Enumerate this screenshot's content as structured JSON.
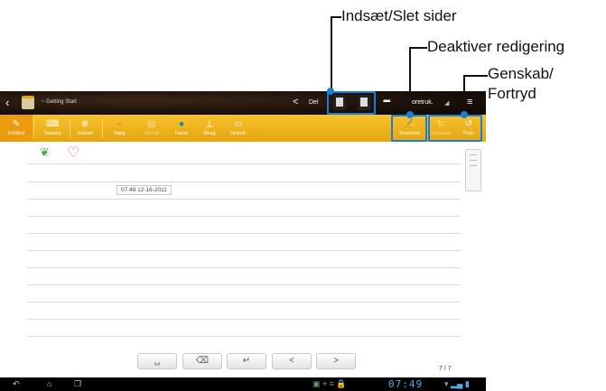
{
  "callouts": {
    "insert_delete": "Indsæt/Slet sider",
    "disable_edit": "Deaktiver redigering",
    "redo_undo_line1": "Genskab/",
    "redo_undo_line2": "Fortryd"
  },
  "topbar": {
    "back_glyph": "‹",
    "title": "~ Getting Start",
    "share_glyph": "<",
    "share_label": "Del",
    "grid_glyph": "▪▪▪",
    "preferences_label": "oretruk.",
    "signal_glyph": "◢",
    "menu_glyph": "≡"
  },
  "toolbar": {
    "freehand": "Frihånd",
    "freehand_glyph": "✎",
    "keyboard": "Tastatur",
    "keyboard_glyph": "⌨",
    "insert": "Indsæt",
    "insert_glyph": "⊕",
    "select": "Vælg",
    "select_glyph": "☝",
    "delete": "Slet alt",
    "delete_glyph": "▤",
    "color": "Farve",
    "color_glyph": "●",
    "stroke": "Streg",
    "stroke_glyph": "⟂",
    "background": "Grundl.",
    "background_glyph": "▭",
    "disable": "Deaktiver",
    "disable_glyph": "✍",
    "redo": "Genskab",
    "redo_glyph": "↻",
    "undo": "Fortr.",
    "undo_glyph": "↺"
  },
  "page": {
    "timestamp": "07:49 12-16-2011",
    "page_number": "7 / 7",
    "sticker_plant": "❦",
    "sticker_heart": "♡"
  },
  "keyboard": {
    "space": "␣",
    "backspace": "⌫",
    "enter": "↵",
    "prev": "<",
    "next": ">"
  },
  "system_bar": {
    "back": "↶",
    "home": "⌂",
    "recent": "❐",
    "clock": "07:49",
    "status_icons": "▣ ⌖ ≡ 🔒",
    "right_icons": "▾ ▂▄ ▮"
  },
  "colors": {
    "toolbar": "#f0b41e",
    "highlight": "#1a7fd0",
    "pen_color": "#1a7fd0"
  }
}
